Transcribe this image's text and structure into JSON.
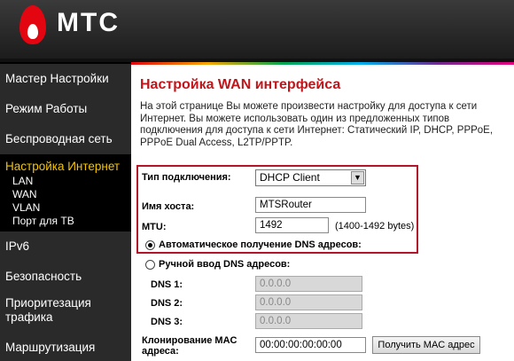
{
  "header": {
    "brand": "МТС"
  },
  "sidebar": {
    "items": [
      {
        "label": "Мастер Настройки"
      },
      {
        "label": "Режим Работы"
      },
      {
        "label": "Беспроводная сеть"
      },
      {
        "label": "IPv6"
      },
      {
        "label": "Безопасность"
      },
      {
        "label": "Приоритезация трафика"
      },
      {
        "label": "Маршрутизация"
      }
    ],
    "active": {
      "label": "Настройка Интернет",
      "subitems": [
        {
          "label": "LAN"
        },
        {
          "label": "WAN"
        },
        {
          "label": "VLAN"
        },
        {
          "label": "Порт для ТВ"
        }
      ]
    }
  },
  "main": {
    "title": "Настройка WAN интерфейса",
    "description": "На этой странице Вы можете произвести настройку для доступа к сети Интернет. Вы можете использовать один из предложенных типов подключения для доступа к сети Интернет: Статический IP, DHCP, PPPoE, PPPoE Dual Access, L2TP/PPTP.",
    "form": {
      "connection_type_label": "Тип подключения:",
      "connection_type_value": "DHCP Client",
      "hostname_label": "Имя хоста:",
      "hostname_value": "MTSRouter",
      "mtu_label": "MTU:",
      "mtu_value": "1492",
      "mtu_hint": "(1400-1492 bytes)",
      "dns_auto_label": "Автоматическое получение DNS адресов:",
      "dns_manual_label": "Ручной ввод DNS адресов:",
      "dns1_label": "DNS 1:",
      "dns1_value": "0.0.0.0",
      "dns2_label": "DNS 2:",
      "dns2_value": "0.0.0.0",
      "dns3_label": "DNS 3:",
      "dns3_value": "0.0.0.0",
      "mac_clone_label": "Клонирование MAC адреса:",
      "mac_value": "00:00:00:00:00:00",
      "get_mac_button": "Получить MAC адрес"
    }
  },
  "colors": {
    "accent_red": "#c0161b",
    "active_menu": "#f5c400",
    "brand_red": "#e30611"
  }
}
